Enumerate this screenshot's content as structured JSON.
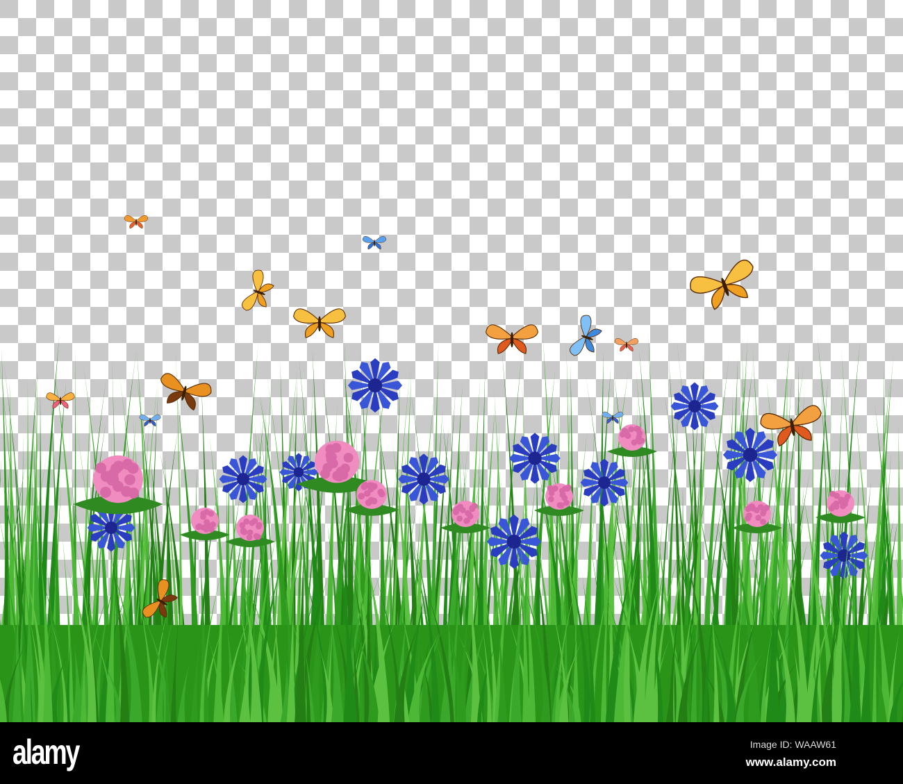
{
  "footer": {
    "logo": "alamy",
    "image_id": "Image ID: WAAW61",
    "website": "www.alamy.com"
  },
  "watermark": "alamy",
  "colors": {
    "checker_grey": "#c9c9c9",
    "grass": "#2e9a1e",
    "cornflower": "#2a3cc0",
    "clover": "#f08cc0",
    "butterfly_orange": "#f2a020"
  }
}
